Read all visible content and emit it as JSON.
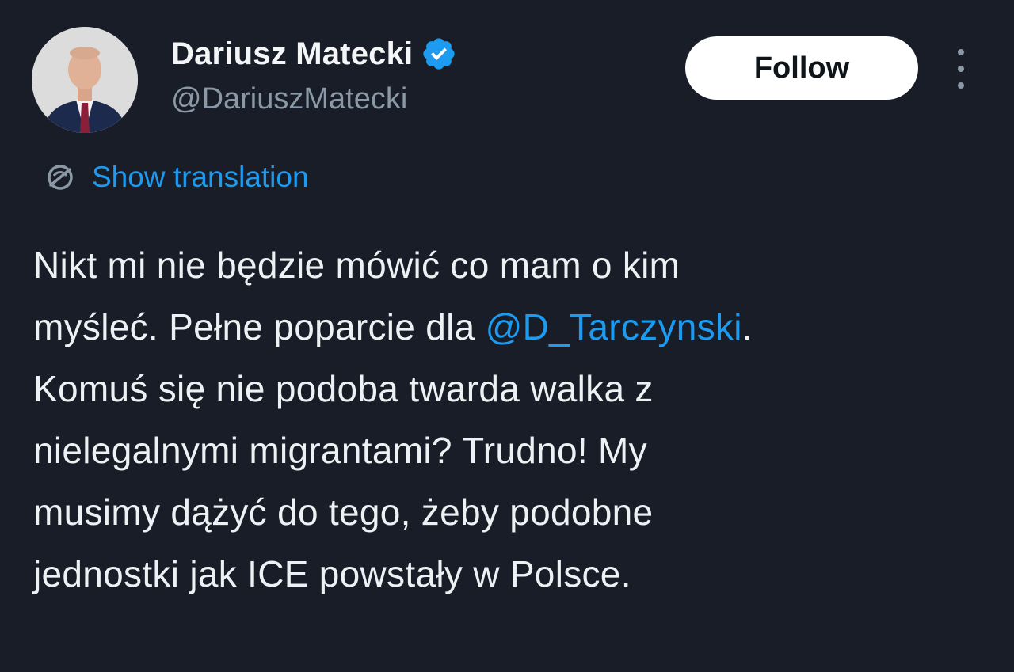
{
  "author": {
    "display_name": "Dariusz Matecki",
    "handle": "@DariuszMatecki",
    "verified": true
  },
  "follow_button": {
    "label": "Follow"
  },
  "translation": {
    "label": "Show translation",
    "icon": "translate-globe-icon"
  },
  "tweet": {
    "line1": "Nikt mi nie będzie mówić co mam o kim",
    "line2_before": "myśleć. Pełne poparcie dla ",
    "line2_mention": "@D_Tarczynski",
    "line2_after": ".",
    "line3": "Komuś się nie podoba twarda walka z",
    "line4": "nielegalnymi migrantami? Trudno! My",
    "line5": "musimy dążyć do tego, żeby podobne",
    "line6": "jednostki jak ICE powstały w Polsce."
  },
  "colors": {
    "background": "#181d27",
    "accent": "#1d9bf0",
    "secondary_text": "#8b98a5",
    "primary_text": "#eef1f4"
  }
}
